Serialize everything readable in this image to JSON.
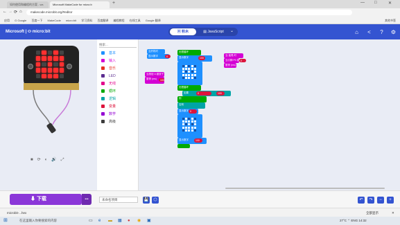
{
  "browser": {
    "tabs": [
      {
        "label": "如何使用和编程的方案 - ws"
      },
      {
        "label": "Microsoft MakeCode for micro:b"
      }
    ],
    "new_tab_label": "+",
    "window_controls": {
      "minimize": "—",
      "maximize": "□",
      "close": "✕"
    },
    "nav": {
      "back": "←",
      "forward": "→",
      "reload": "⟳",
      "home": "⌂"
    },
    "url": "makecode.microbit.org/#editor",
    "bookmarks": [
      "应用",
      "G Google",
      "百度一下",
      "MakeCode",
      "micro:bit",
      "学习资料",
      "百度翻译",
      "编程教程",
      "在线工具",
      "Google 翻译",
      "其他书签"
    ]
  },
  "makecode": {
    "brand": "Microsoft | ⬭ micro:bit",
    "mode_blocks": "▣ 积木",
    "mode_js": "▤ JavaScript",
    "mode_dropdown": "⌄",
    "header_icons": [
      "home-icon",
      "share-icon",
      "help-icon",
      "settings-icon"
    ],
    "header_glyphs": [
      "⌂",
      "<",
      "?",
      "⚙"
    ]
  },
  "simulator": {
    "controls": [
      "■",
      "⟳",
      "◐",
      "🔊",
      "⤢"
    ],
    "leds": [
      0,
      1,
      0,
      1,
      0,
      1,
      1,
      1,
      1,
      1,
      1,
      0,
      1,
      0,
      1,
      1,
      1,
      1,
      1,
      1,
      0,
      1,
      1,
      1,
      0
    ]
  },
  "toolbox": {
    "search_placeholder": "搜索...",
    "categories": [
      {
        "label": "基本",
        "color": "#1e90ff"
      },
      {
        "label": "输入",
        "color": "#d400d4"
      },
      {
        "label": "音乐",
        "color": "#e63022"
      },
      {
        "label": "LED",
        "color": "#5c2d91"
      },
      {
        "label": "无线",
        "color": "#e3008c"
      },
      {
        "label": "循环",
        "color": "#00aa00"
      },
      {
        "label": "逻辑",
        "color": "#00a4a6"
      },
      {
        "label": "变量",
        "color": "#dc143c"
      },
      {
        "label": "数学",
        "color": "#9400d3"
      },
      {
        "label": "高级",
        "color": "#3c3c3c"
      }
    ]
  },
  "blocks": {
    "on_start": "当开机时",
    "forever": "无限循环",
    "on_button_a": "当按钮 A 被按下",
    "on_shake": "当 摇晃 时",
    "on_pin": "当引脚 P0 被触摸",
    "show_number": "显示数字",
    "show_leds": "显示 LED",
    "pause": "暂停 (ms)",
    "if_label": "如果",
    "then_label": "则",
    "else_label": "否则",
    "value_a": "100",
    "value_b": "0"
  },
  "bottom": {
    "download_label": "下载",
    "download_icon": "⬇",
    "more_label": "•••",
    "project_name": "未命名项目",
    "save_icon": "💾",
    "github_icon": "⬡",
    "undo": "↶",
    "redo": "↷",
    "zoom_out": "−",
    "zoom_in": "+"
  },
  "downloads_bar": {
    "file": "microbit-...hex",
    "show_all": "全部显示",
    "close": "✕"
  },
  "taskbar": {
    "start": "⊞",
    "search_placeholder": "在这里输入你要搜索的内容",
    "tray": "27°C  ⌃  ENG  14:32"
  },
  "colors": {
    "header": "#3454d1",
    "download": "#8b37d8",
    "basic_block": "#1e90ff",
    "loop_block": "#00aa00",
    "logic_block": "#00a4a6",
    "input_block": "#d400d4",
    "variable_block": "#dc143c"
  }
}
